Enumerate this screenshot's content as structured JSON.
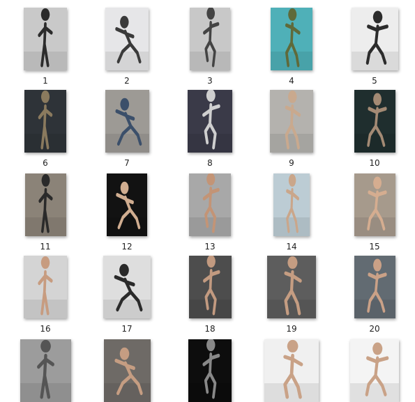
{
  "thumbnails": [
    {
      "caption": "1",
      "bg": "#c9c9c9",
      "fg": "#2b2b2b"
    },
    {
      "caption": "2",
      "bg": "#e6e6e8",
      "fg": "#3a3a3a"
    },
    {
      "caption": "3",
      "bg": "#c8c8c8",
      "fg": "#444444"
    },
    {
      "caption": "4",
      "bg": "#4fb0b8",
      "fg": "#5f6a3a"
    },
    {
      "caption": "5",
      "bg": "#ededed",
      "fg": "#2c2c2c"
    },
    {
      "caption": "6",
      "bg": "#2e3338",
      "fg": "#8a7a5e"
    },
    {
      "caption": "7",
      "bg": "#9d9a95",
      "fg": "#3b4f6a"
    },
    {
      "caption": "8",
      "bg": "#3a3a48",
      "fg": "#cfcfcf"
    },
    {
      "caption": "9",
      "bg": "#b4b2ae",
      "fg": "#c9a98e"
    },
    {
      "caption": "10",
      "bg": "#1f2e2e",
      "fg": "#a38a74"
    },
    {
      "caption": "11",
      "bg": "#8b8378",
      "fg": "#2a2a2a"
    },
    {
      "caption": "12",
      "bg": "#121212",
      "fg": "#d0ad90"
    },
    {
      "caption": "13",
      "bg": "#a8a8a8",
      "fg": "#c39476"
    },
    {
      "caption": "14",
      "bg": "#bcccd4",
      "fg": "#caa68a"
    },
    {
      "caption": "15",
      "bg": "#a69a8c",
      "fg": "#d5ad90"
    },
    {
      "caption": "16",
      "bg": "#d4d4d4",
      "fg": "#c79c80"
    },
    {
      "caption": "17",
      "bg": "#dedede",
      "fg": "#2a2a2a"
    },
    {
      "caption": "18",
      "bg": "#4d4d4d",
      "fg": "#c29a80"
    },
    {
      "caption": "19",
      "bg": "#5d5d5d",
      "fg": "#c59d82"
    },
    {
      "caption": "20",
      "bg": "#626b72",
      "fg": "#caa187"
    },
    {
      "caption": "",
      "bg": "#9c9c9c",
      "fg": "#555555"
    },
    {
      "caption": "",
      "bg": "#6e6a66",
      "fg": "#c59d82"
    },
    {
      "caption": "",
      "bg": "#0d0d0d",
      "fg": "#888888"
    },
    {
      "caption": "",
      "bg": "#f0f0f0",
      "fg": "#c9a287"
    },
    {
      "caption": "",
      "bg": "#f4f4f4",
      "fg": "#c9a287"
    }
  ]
}
